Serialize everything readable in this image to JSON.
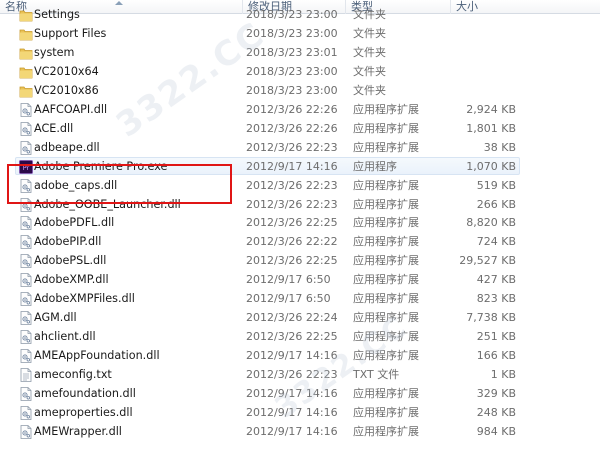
{
  "header": {
    "name": "名称",
    "date": "修改日期",
    "type": "类型",
    "size": "大小"
  },
  "files": [
    {
      "icon": "folder-icon",
      "name": "Settings",
      "date": "2018/3/23 23:00",
      "type": "文件夹",
      "size": ""
    },
    {
      "icon": "folder-icon",
      "name": "Support Files",
      "date": "2018/3/23 23:00",
      "type": "文件夹",
      "size": ""
    },
    {
      "icon": "folder-icon",
      "name": "system",
      "date": "2018/3/23 23:01",
      "type": "文件夹",
      "size": ""
    },
    {
      "icon": "folder-icon",
      "name": "VC2010x64",
      "date": "2018/3/23 23:00",
      "type": "文件夹",
      "size": ""
    },
    {
      "icon": "folder-icon",
      "name": "VC2010x86",
      "date": "2018/3/23 23:00",
      "type": "文件夹",
      "size": ""
    },
    {
      "icon": "dll-file-icon",
      "name": "AAFCOAPI.dll",
      "date": "2012/3/26 22:26",
      "type": "应用程序扩展",
      "size": "2,924 KB"
    },
    {
      "icon": "dll-file-icon",
      "name": "ACE.dll",
      "date": "2012/3/26 22:26",
      "type": "应用程序扩展",
      "size": "1,801 KB"
    },
    {
      "icon": "dll-file-icon",
      "name": "adbeape.dll",
      "date": "2012/3/26 22:23",
      "type": "应用程序扩展",
      "size": "38 KB"
    },
    {
      "icon": "premiere-app-icon",
      "name": "Adobe Premiere Pro.exe",
      "date": "2012/9/17 14:16",
      "type": "应用程序",
      "size": "1,070 KB"
    },
    {
      "icon": "dll-file-icon",
      "name": "adobe_caps.dll",
      "date": "2012/3/26 22:23",
      "type": "应用程序扩展",
      "size": "519 KB"
    },
    {
      "icon": "dll-file-icon",
      "name": "Adobe_OOBE_Launcher.dll",
      "date": "2012/3/26 22:23",
      "type": "应用程序扩展",
      "size": "266 KB"
    },
    {
      "icon": "dll-file-icon",
      "name": "AdobePDFL.dll",
      "date": "2012/3/26 22:25",
      "type": "应用程序扩展",
      "size": "8,820 KB"
    },
    {
      "icon": "dll-file-icon",
      "name": "AdobePIP.dll",
      "date": "2012/3/26 22:22",
      "type": "应用程序扩展",
      "size": "724 KB"
    },
    {
      "icon": "dll-file-icon",
      "name": "AdobePSL.dll",
      "date": "2012/3/26 22:25",
      "type": "应用程序扩展",
      "size": "29,527 KB"
    },
    {
      "icon": "dll-file-icon",
      "name": "AdobeXMP.dll",
      "date": "2012/9/17 6:50",
      "type": "应用程序扩展",
      "size": "427 KB"
    },
    {
      "icon": "dll-file-icon",
      "name": "AdobeXMPFiles.dll",
      "date": "2012/9/17 6:50",
      "type": "应用程序扩展",
      "size": "823 KB"
    },
    {
      "icon": "dll-file-icon",
      "name": "AGM.dll",
      "date": "2012/3/26 22:24",
      "type": "应用程序扩展",
      "size": "7,738 KB"
    },
    {
      "icon": "dll-file-icon",
      "name": "ahclient.dll",
      "date": "2012/3/26 22:25",
      "type": "应用程序扩展",
      "size": "251 KB"
    },
    {
      "icon": "dll-file-icon",
      "name": "AMEAppFoundation.dll",
      "date": "2012/9/17 14:16",
      "type": "应用程序扩展",
      "size": "166 KB"
    },
    {
      "icon": "txt-file-icon",
      "name": "ameconfig.txt",
      "date": "2012/3/26 22:23",
      "type": "TXT 文件",
      "size": "1 KB"
    },
    {
      "icon": "dll-file-icon",
      "name": "amefoundation.dll",
      "date": "2012/9/17 14:16",
      "type": "应用程序扩展",
      "size": "329 KB"
    },
    {
      "icon": "dll-file-icon",
      "name": "ameproperties.dll",
      "date": "2012/9/17 14:16",
      "type": "应用程序扩展",
      "size": "248 KB"
    },
    {
      "icon": "dll-file-icon",
      "name": "AMEWrapper.dll",
      "date": "2012/9/17 14:16",
      "type": "应用程序扩展",
      "size": "984 KB"
    }
  ],
  "highlight_row": 8,
  "watermark": {
    "line1": "3322.CC",
    "line2": "3322.CC"
  },
  "colors": {
    "highlight_border": "#e01515",
    "folder": "#e9c256",
    "premiere_bg": "#2a0a4a",
    "premiere_text": "#d9a8ff"
  }
}
